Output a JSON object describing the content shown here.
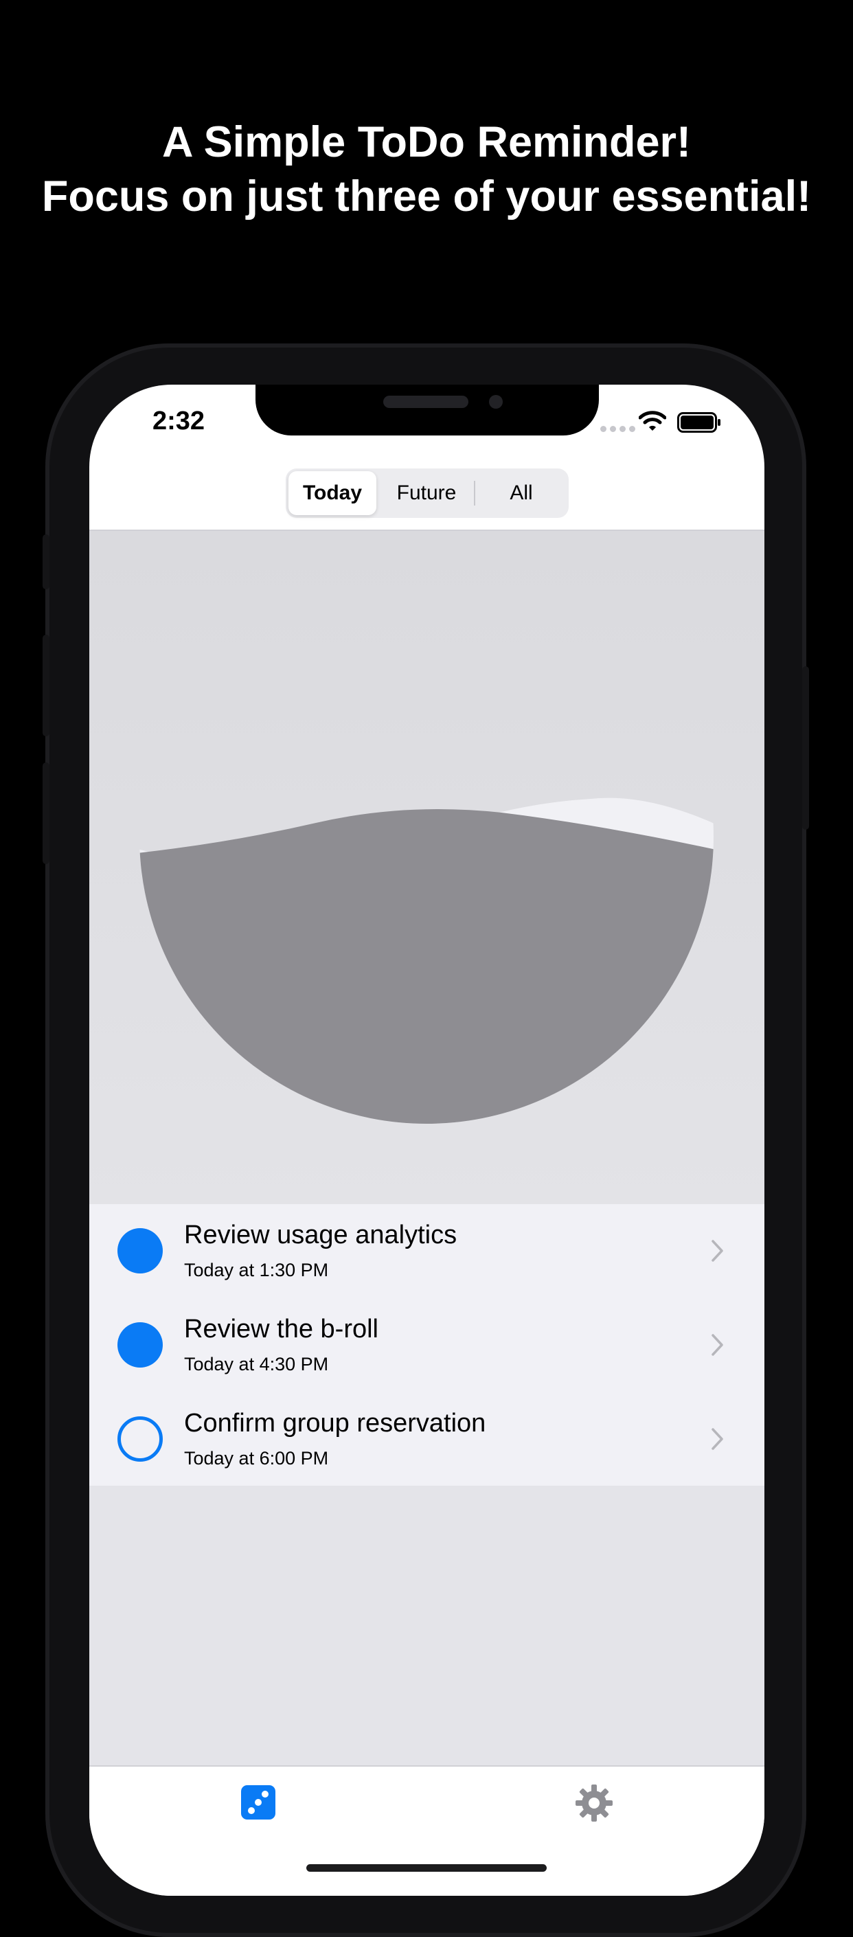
{
  "headline": {
    "line1": "A Simple ToDo Reminder!",
    "line2": "Focus on just three of your essential!"
  },
  "status_bar": {
    "time": "2:32",
    "icons": [
      "cellular-dots-icon",
      "wifi-icon",
      "battery-icon"
    ]
  },
  "segmented_control": {
    "items": [
      {
        "label": "Today",
        "selected": true
      },
      {
        "label": "Future",
        "selected": false
      },
      {
        "label": "All",
        "selected": false
      }
    ]
  },
  "progress_gauge": {
    "description_icon": "water-bowl-progress-icon",
    "fill_fraction": 0.67
  },
  "tasks": [
    {
      "title": "Review usage analytics",
      "time": "Today at 1:30 PM",
      "done": true
    },
    {
      "title": "Review the b-roll",
      "time": "Today at 4:30 PM",
      "done": true
    },
    {
      "title": "Confirm group reservation",
      "time": "Today at 6:00 PM",
      "done": false
    }
  ],
  "tab_bar": {
    "items": [
      {
        "icon": "dice-icon",
        "selected": true
      },
      {
        "icon": "gear-icon",
        "selected": false
      }
    ]
  },
  "colors": {
    "accent": "#0a7bf5",
    "fill_gray": "#8e8d92",
    "wave_light": "#f1f1f5",
    "list_bg": "#f1f1f6"
  }
}
